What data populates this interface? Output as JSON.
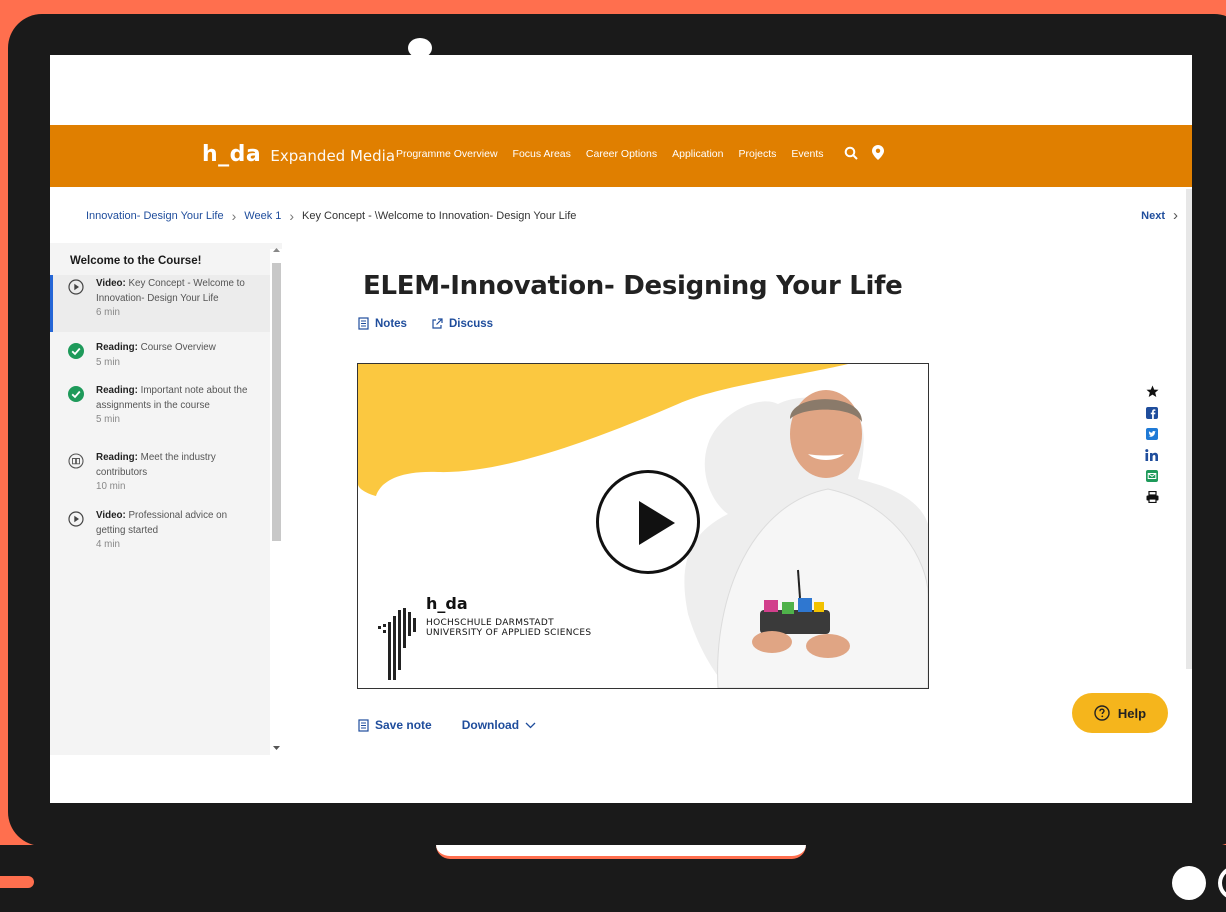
{
  "brand": {
    "logo": "h_da",
    "name": "Expanded Media"
  },
  "nav": [
    "Programme Overview",
    "Focus Areas",
    "Career Options",
    "Application",
    "Projects",
    "Events"
  ],
  "breadcrumb": {
    "course": "Innovation- Design Your Life",
    "week": "Week 1",
    "current": "Key Concept - \\Welcome to Innovation- Design Your Life"
  },
  "next_label": "Next",
  "sidebar": {
    "title": "Welcome to the Course!",
    "items": [
      {
        "type": "Video:",
        "label": "Key Concept - Welcome to Innovation- Design Your Life",
        "duration": "6 min",
        "icon": "play-circle-icon",
        "state": "active"
      },
      {
        "type": "Reading:",
        "label": "Course Overview",
        "duration": "5 min",
        "icon": "check-circle-icon",
        "state": "completed"
      },
      {
        "type": "Reading:",
        "label": "Important note about the assignments in the course",
        "duration": "5 min",
        "icon": "check-circle-icon",
        "state": "completed"
      },
      {
        "type": "Reading:",
        "label": "Meet the industry contributors",
        "duration": "10 min",
        "icon": "book-icon",
        "state": "todo"
      },
      {
        "type": "Video:",
        "label": "Professional advice on getting started",
        "duration": "4 min",
        "icon": "play-circle-icon",
        "state": "todo"
      }
    ]
  },
  "main": {
    "title": "ELEM-Innovation- Designing Your Life",
    "notes_label": "Notes",
    "discuss_label": "Discuss",
    "save_note_label": "Save note",
    "download_label": "Download"
  },
  "video": {
    "logo": "h_da",
    "institution_line1": "HOCHSCHULE DARMSTADT",
    "institution_line2": "UNIVERSITY OF APPLIED SCIENCES"
  },
  "help_label": "Help",
  "colors": {
    "brand_orange": "#e07f00",
    "link_blue": "#1f4d9c",
    "help_yellow": "#f5b51c",
    "check_green": "#1e9a5a",
    "video_yellow": "#fbc840",
    "frame_coral": "#ff6f4e"
  }
}
